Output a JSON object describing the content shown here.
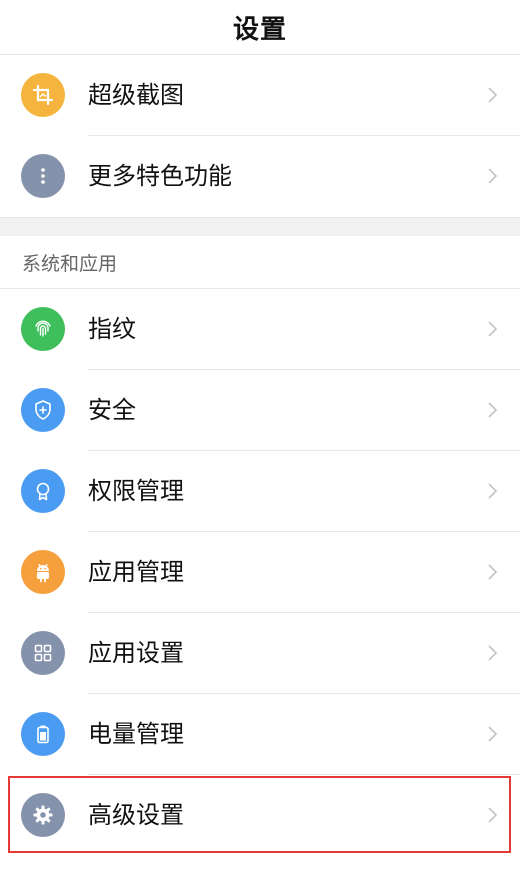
{
  "header": {
    "title": "设置"
  },
  "top_items": [
    {
      "label": "超级截图",
      "icon": "screenshot-crop-icon",
      "color": "#F5B43D"
    },
    {
      "label": "更多特色功能",
      "icon": "more-dots-icon",
      "color": "#8592AB"
    }
  ],
  "section": {
    "title": "系统和应用",
    "items": [
      {
        "label": "指纹",
        "icon": "fingerprint-icon",
        "color": "#3FBF5C"
      },
      {
        "label": "安全",
        "icon": "shield-icon",
        "color": "#4A9BF2"
      },
      {
        "label": "权限管理",
        "icon": "badge-icon",
        "color": "#4A9BF2"
      },
      {
        "label": "应用管理",
        "icon": "android-icon",
        "color": "#F5A03D"
      },
      {
        "label": "应用设置",
        "icon": "grid-icon",
        "color": "#8592AB"
      },
      {
        "label": "电量管理",
        "icon": "battery-icon",
        "color": "#4A9BF2"
      },
      {
        "label": "高级设置",
        "icon": "gear-icon",
        "color": "#8592AB"
      }
    ]
  }
}
